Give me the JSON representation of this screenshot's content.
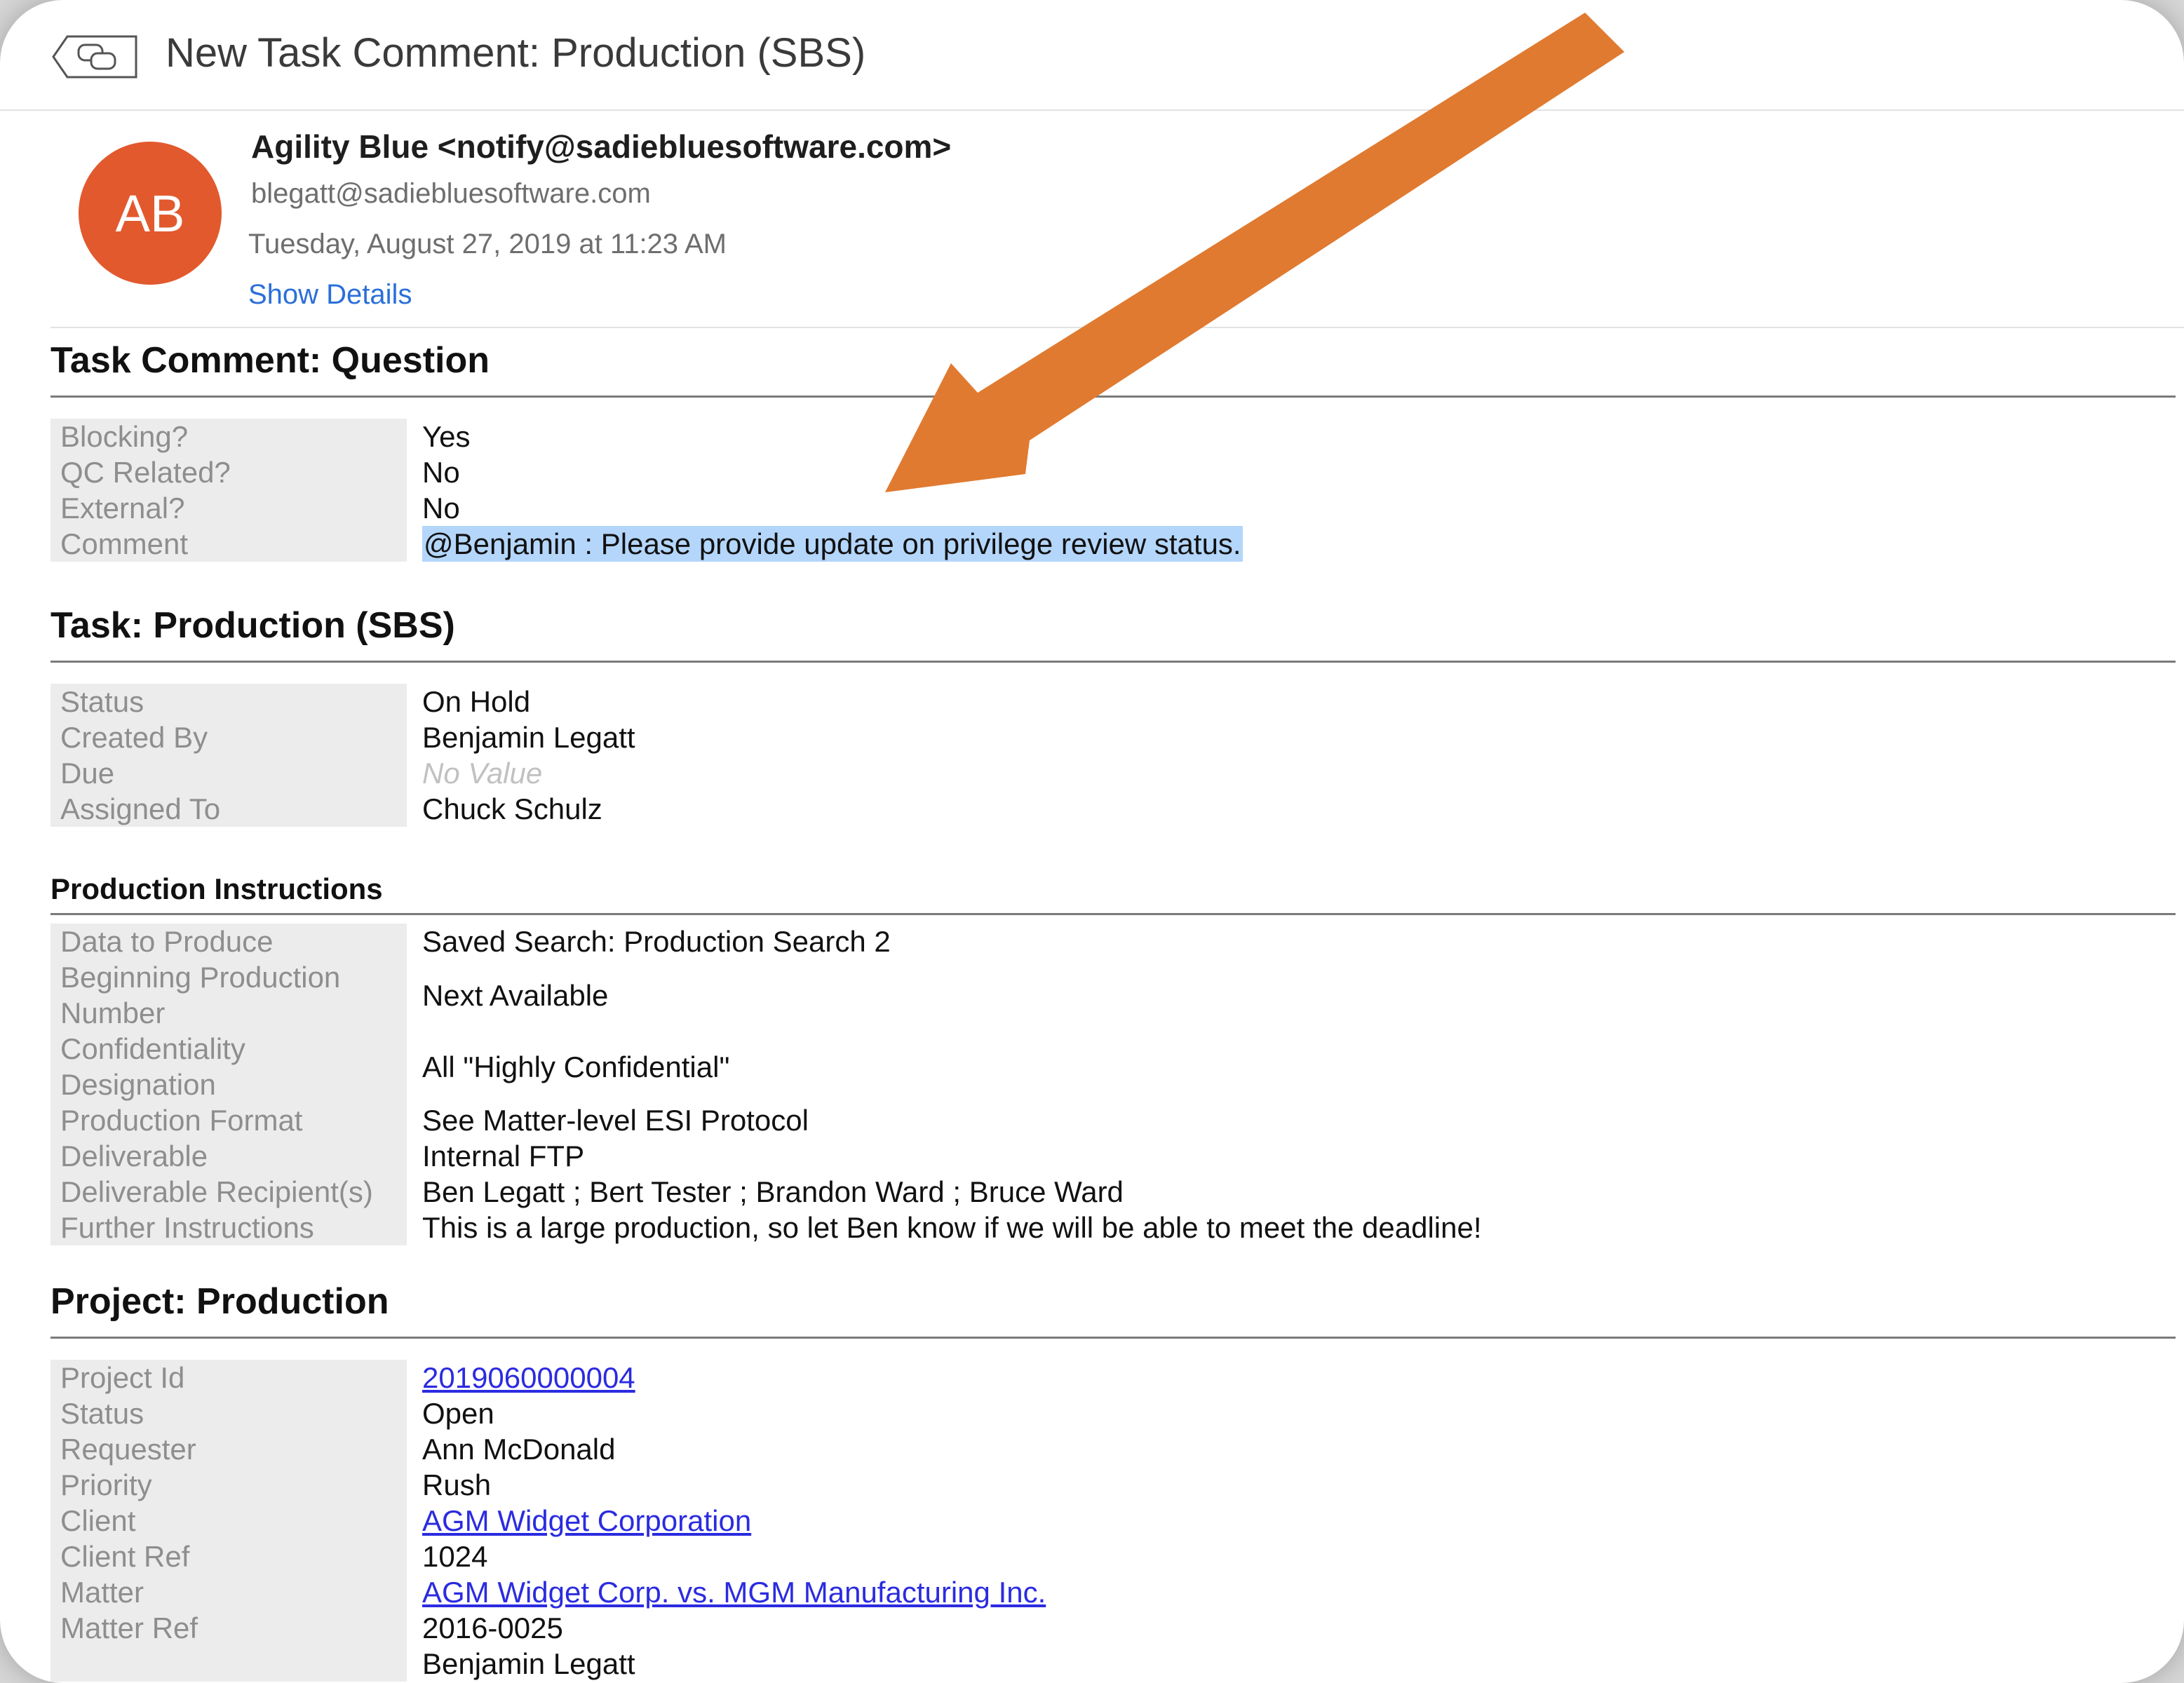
{
  "window": {
    "subject": "New Task Comment: Production (SBS)"
  },
  "header": {
    "avatar_initials": "AB",
    "sender": "Agility Blue <notify@sadiebluesoftware.com>",
    "to": "blegatt@sadiebluesoftware.com",
    "date": "Tuesday, August 27, 2019 at 11:23 AM",
    "show_details": "Show Details"
  },
  "task_comment": {
    "title": "Task Comment: Question",
    "rows": [
      {
        "label": "Blocking?",
        "value": "Yes"
      },
      {
        "label": "QC Related?",
        "value": "No"
      },
      {
        "label": "External?",
        "value": "No"
      },
      {
        "label": "Comment",
        "value": "@Benjamin : Please provide update on privilege review status."
      }
    ]
  },
  "task": {
    "title": "Task: Production (SBS)",
    "rows": [
      {
        "label": "Status",
        "value": "On Hold"
      },
      {
        "label": "Created By",
        "value": "Benjamin Legatt"
      },
      {
        "label": "Due",
        "value": "No Value"
      },
      {
        "label": "Assigned To",
        "value": "Chuck Schulz"
      }
    ]
  },
  "production_instructions": {
    "title": "Production Instructions",
    "rows": [
      {
        "label": "Data to Produce",
        "value": "Saved Search: Production Search 2"
      },
      {
        "label": "Beginning Production Number",
        "value": "Next Available"
      },
      {
        "label": "Confidentiality Designation",
        "value": "All \"Highly Confidential\""
      },
      {
        "label": "Production Format",
        "value": "See Matter-level ESI Protocol"
      },
      {
        "label": "Deliverable",
        "value": "Internal FTP"
      },
      {
        "label": "Deliverable Recipient(s)",
        "value": "Ben Legatt ; Bert Tester ; Brandon Ward ; Bruce Ward"
      },
      {
        "label": "Further Instructions",
        "value": "This is a large production, so let Ben know if we will be able to meet the deadline!"
      }
    ]
  },
  "project": {
    "title": "Project: Production",
    "rows": [
      {
        "label": "Project Id",
        "value": "2019060000004"
      },
      {
        "label": "Status",
        "value": "Open"
      },
      {
        "label": "Requester",
        "value": "Ann McDonald"
      },
      {
        "label": "Priority",
        "value": "Rush"
      },
      {
        "label": "Client",
        "value": "AGM Widget Corporation"
      },
      {
        "label": "Client Ref",
        "value": "1024"
      },
      {
        "label": "Matter",
        "value": "AGM Widget Corp. vs. MGM Manufacturing Inc."
      },
      {
        "label": "Matter Ref",
        "value": "2016-0025"
      },
      {
        "label": "",
        "value": "Benjamin Legatt"
      }
    ]
  },
  "colors": {
    "arrow": "#e07a30",
    "avatar": "#e2592e",
    "link": "#2b2be0",
    "highlight": "#b4d6fb",
    "label_bg": "#ececec"
  }
}
